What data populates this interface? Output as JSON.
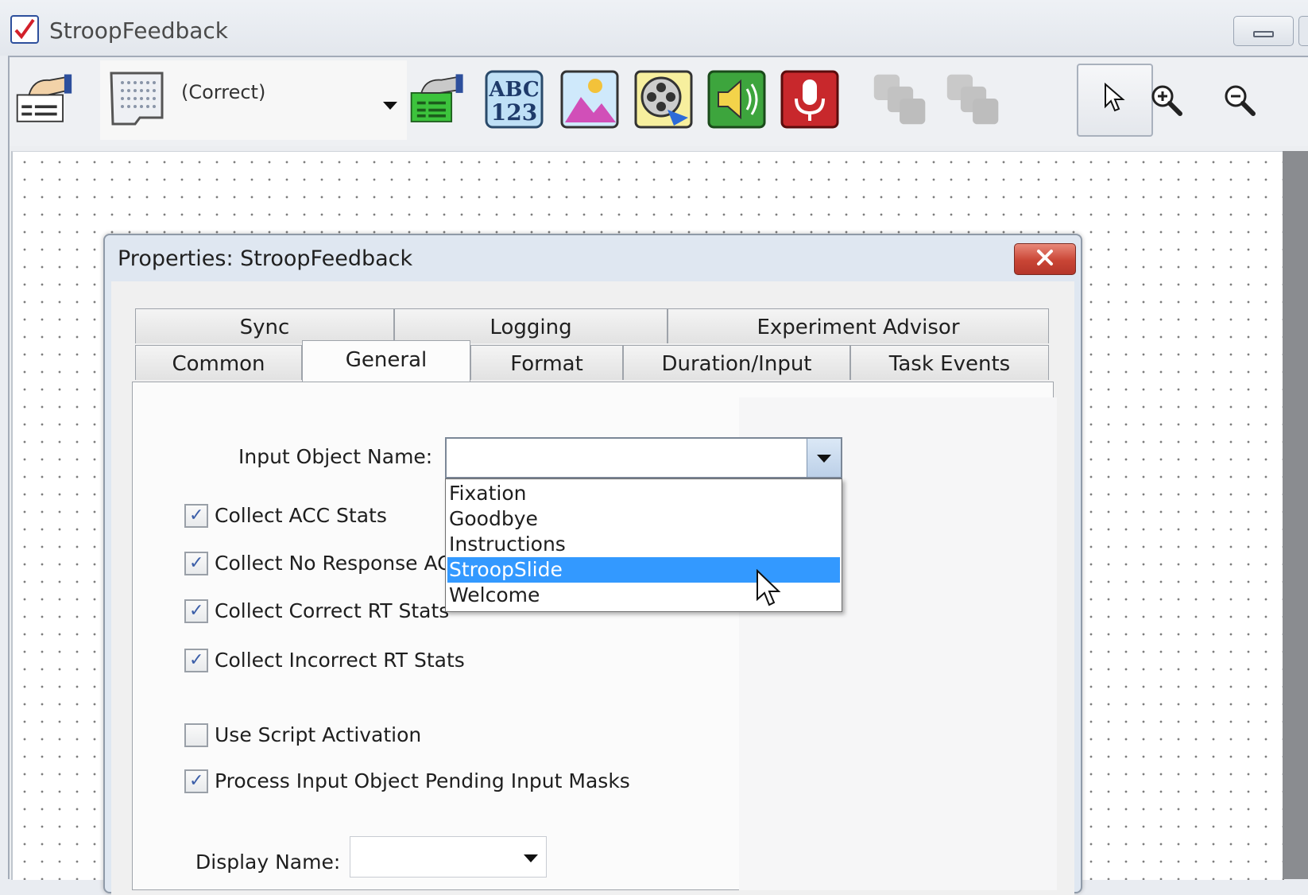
{
  "window": {
    "title": "StroopFeedback"
  },
  "toolbar": {
    "object_combo_value": "(Correct)",
    "tools": [
      "feedback-display-icon",
      "slide-state-icon",
      "add-state-icon",
      "text-icon",
      "image-icon",
      "movie-icon",
      "sound-out-icon",
      "sound-in-icon",
      "bring-forward-icon",
      "send-backward-icon",
      "pointer-icon",
      "zoom-in-icon",
      "zoom-out-icon"
    ]
  },
  "dialog": {
    "title": "Properties: StroopFeedback",
    "tabs_row1": [
      "Sync",
      "Logging",
      "Experiment Advisor"
    ],
    "tabs_row2": [
      "Common",
      "General",
      "Format",
      "Duration/Input",
      "Task Events"
    ],
    "active_tab": "General",
    "input_object_label": "Input Object Name:",
    "input_object_value": "",
    "dropdown_options": [
      "Fixation",
      "Goodbye",
      "Instructions",
      "StroopSlide",
      "Welcome"
    ],
    "dropdown_selected": "StroopSlide",
    "checkboxes": [
      {
        "label": "Collect ACC Stats",
        "checked": true
      },
      {
        "label": "Collect No Response AC",
        "checked": true
      },
      {
        "label": "Collect Correct RT Stats",
        "checked": true
      },
      {
        "label": "Collect Incorrect RT Stats",
        "checked": true
      },
      {
        "label": "Use Script Activation",
        "checked": false
      },
      {
        "label": "Process Input Object Pending Input Masks",
        "checked": true
      }
    ],
    "display_name_label": "Display Name:",
    "display_name_value": ""
  },
  "colors": {
    "selection": "#3399ff",
    "close_button": "#c94535",
    "checkbox_tick": "#3b5ea8"
  }
}
